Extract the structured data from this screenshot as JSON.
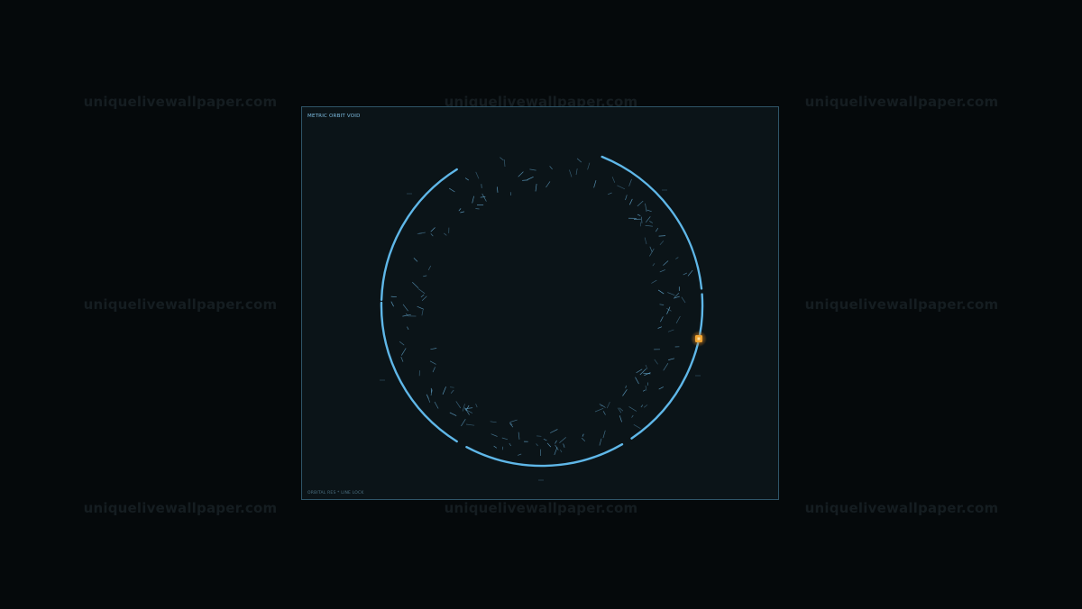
{
  "watermark_text": "uniquelivewallpaper.com",
  "panel": {
    "title": "METRIC ORBIT VOID",
    "status": "ORBITAL RES * LINE LOCK"
  },
  "colors": {
    "background": "#05090b",
    "panel": "#0b1418",
    "panel_border": "#2f5568",
    "ring": "#5fb7e8",
    "particle": "#5f9fc4",
    "marker": "#f5a623",
    "watermark": "#151d21"
  },
  "icons": {
    "orbit_marker": "glowing-orange-square"
  }
}
